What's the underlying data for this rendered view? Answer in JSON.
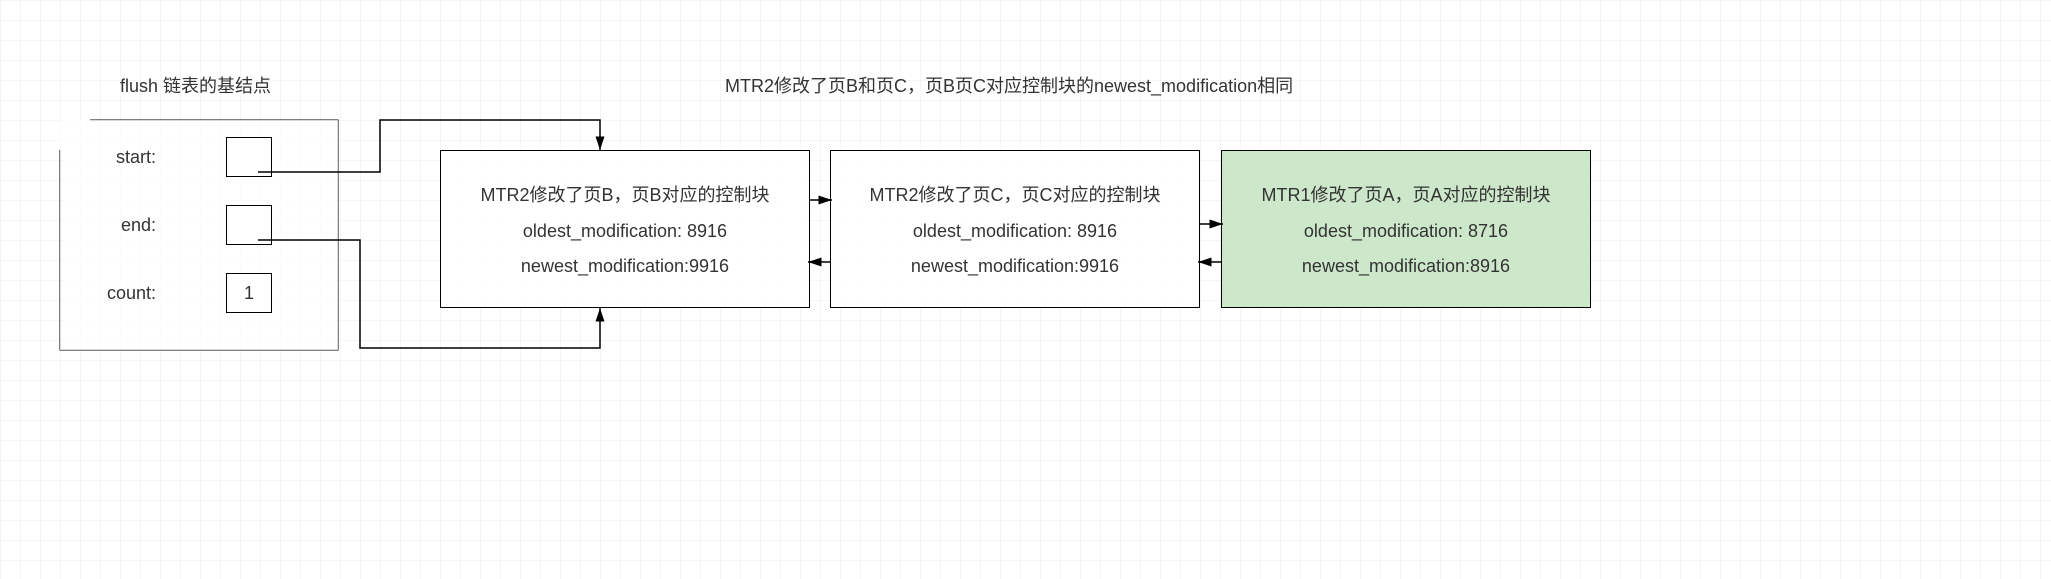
{
  "title_left": "flush 链表的基结点",
  "title_right": "MTR2修改了页B和页C，页B页C对应控制块的newest_modification相同",
  "base": {
    "start_label": "start:",
    "end_label": "end:",
    "count_label": "count:",
    "count_value": "1"
  },
  "blocks": [
    {
      "title": "MTR2修改了页B，页B对应的控制块",
      "oldest": "oldest_modification: 8916",
      "newest": "newest_modification:9916"
    },
    {
      "title": "MTR2修改了页C，页C对应的控制块",
      "oldest": "oldest_modification: 8916",
      "newest": "newest_modification:9916"
    },
    {
      "title": "MTR1修改了页A，页A对应的控制块",
      "oldest": "oldest_modification: 8716",
      "newest": "newest_modification:8916"
    }
  ]
}
